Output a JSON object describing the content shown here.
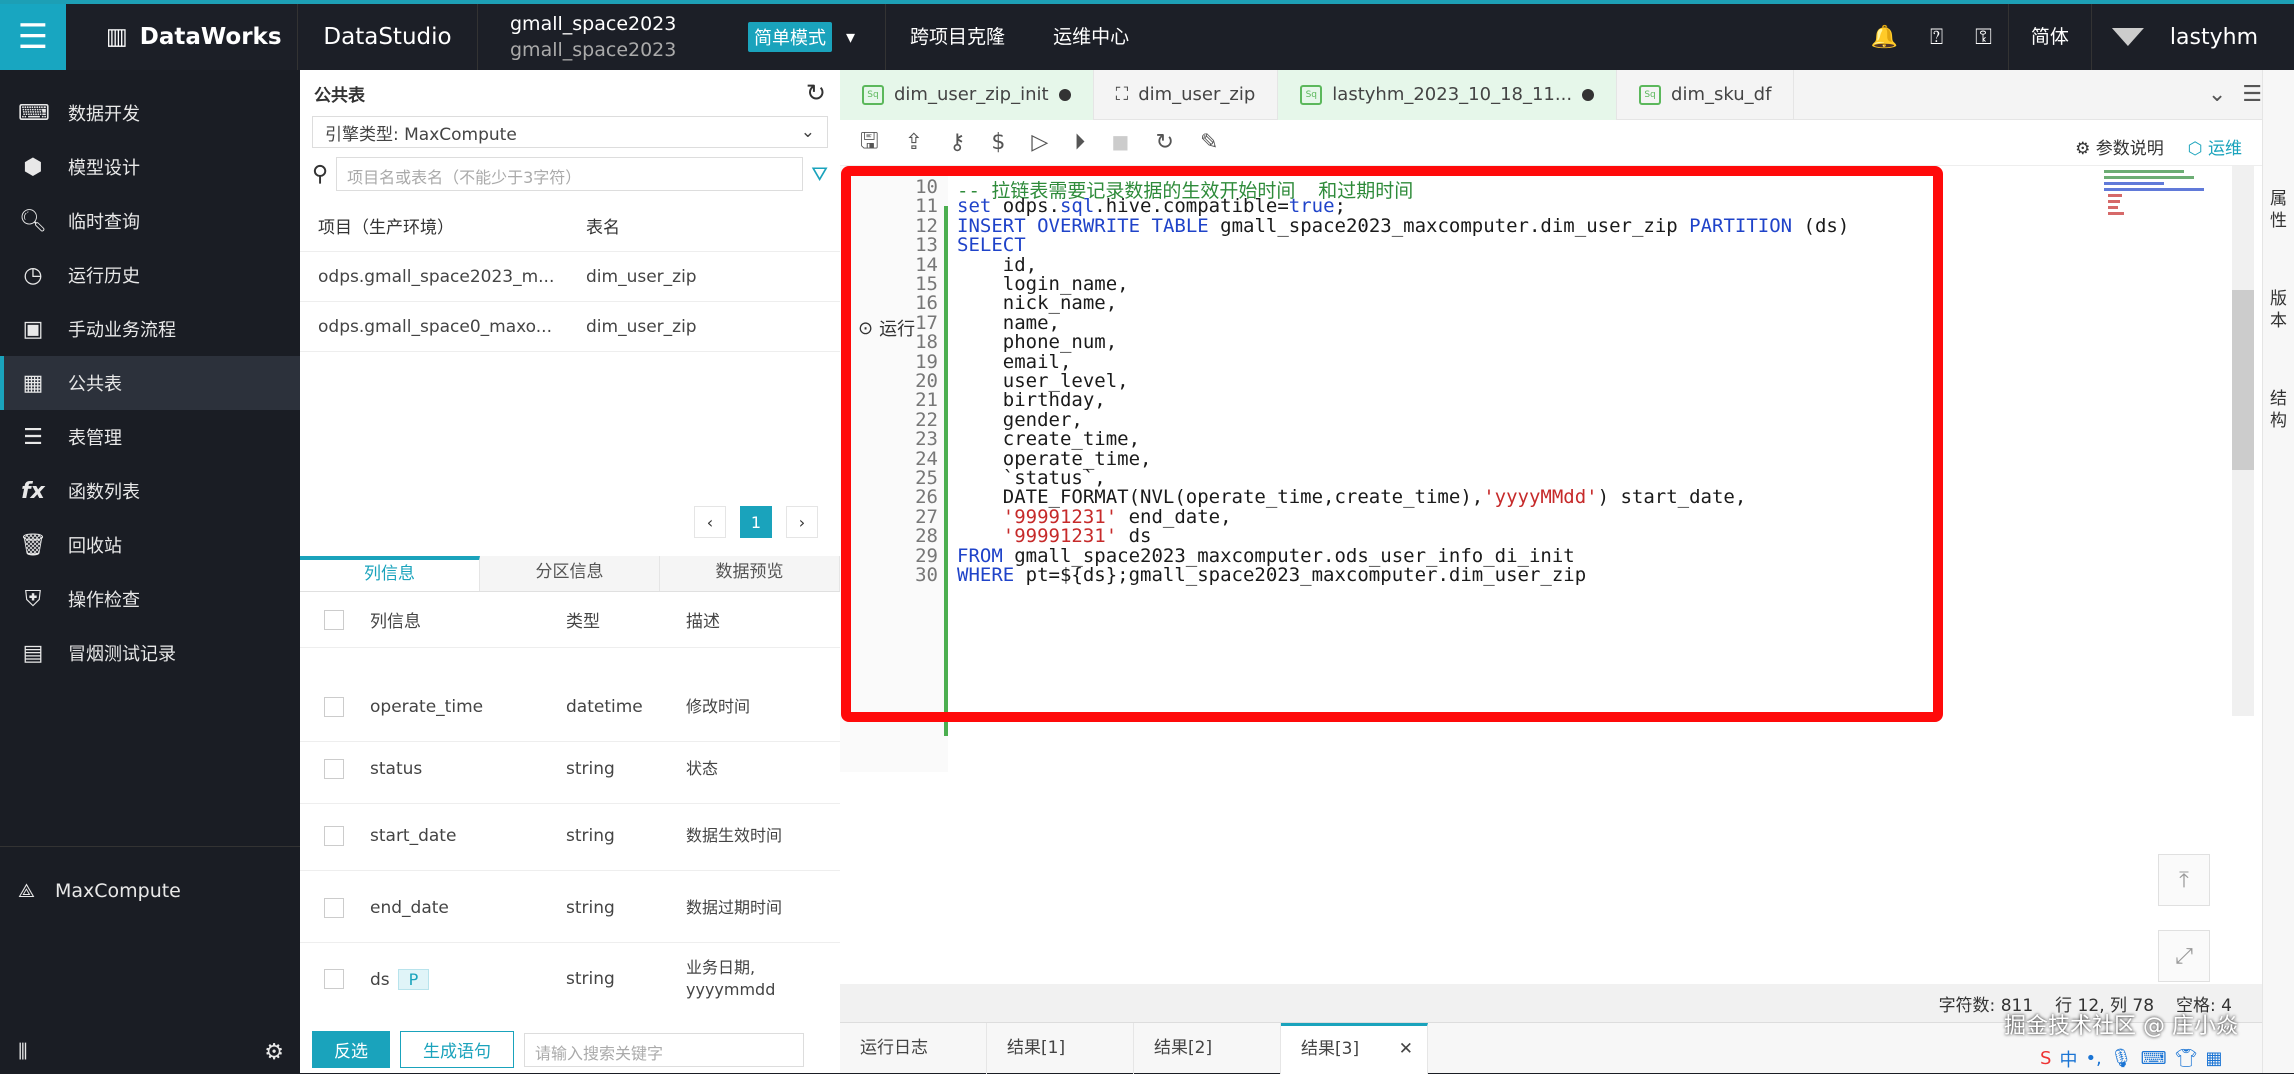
{
  "topbar": {
    "brand": "DataWorks",
    "studio": "DataStudio",
    "project_line1": "gmall_space2023",
    "project_line2": "gmall_space2023",
    "mode": "简单模式",
    "nav": [
      "跨项目克隆",
      "运维中心"
    ],
    "lang": "简体",
    "user": "lastyhm"
  },
  "sidebar": {
    "items": [
      {
        "label": "数据开发",
        "icon": "code-icon"
      },
      {
        "label": "模型设计",
        "icon": "cube-icon"
      },
      {
        "label": "临时查询",
        "icon": "search-icon"
      },
      {
        "label": "运行历史",
        "icon": "clock-icon"
      },
      {
        "label": "手动业务流程",
        "icon": "briefcase-icon"
      },
      {
        "label": "公共表",
        "icon": "table-icon",
        "active": true
      },
      {
        "label": "表管理",
        "icon": "table-manage-icon"
      },
      {
        "label": "函数列表",
        "icon": "function-icon"
      },
      {
        "label": "回收站",
        "icon": "trash-icon"
      },
      {
        "label": "操作检查",
        "icon": "shield-icon"
      },
      {
        "label": "冒烟测试记录",
        "icon": "log-icon"
      }
    ],
    "engine": "MaxCompute"
  },
  "public_table": {
    "title": "公共表",
    "engine_select": "引擎类型:  MaxCompute",
    "search_placeholder": "项目名或表名（不能少于3字符）",
    "col_project": "项目（生产环境）",
    "col_table": "表名",
    "rows": [
      {
        "project": "odps.gmall_space2023_m...",
        "table": "dim_user_zip"
      },
      {
        "project": "odps.gmall_space0_maxo...",
        "table": "dim_user_zip"
      }
    ],
    "page": "1"
  },
  "detail": {
    "tabs": [
      "列信息",
      "分区信息",
      "数据预览"
    ],
    "headers": [
      "列信息",
      "类型",
      "描述"
    ],
    "rows": [
      {
        "name": "operate_time",
        "type": "datetime",
        "desc": "修改时间"
      },
      {
        "name": "status",
        "type": "string",
        "desc": "状态"
      },
      {
        "name": "start_date",
        "type": "string",
        "desc": "数据生效时间"
      },
      {
        "name": "end_date",
        "type": "string",
        "desc": "数据过期时间"
      },
      {
        "name": "ds",
        "type": "string",
        "desc": "业务日期, yyyymmdd",
        "badge": "P"
      }
    ],
    "btn_invert": "反选",
    "btn_generate": "生成语句",
    "search_placeholder": "请输入搜索关键字"
  },
  "editor": {
    "tabs": [
      {
        "label": "dim_user_zip_init",
        "dirty": true
      },
      {
        "label": "dim_user_zip",
        "dirty": false
      },
      {
        "label": "lastyhm_2023_10_18_11...",
        "dirty": true
      },
      {
        "label": "dim_sku_df",
        "dirty": false
      }
    ],
    "toolbar_right": [
      "参数说明",
      "运维"
    ],
    "run_label": "运行",
    "lines": [
      {
        "n": "10",
        "t": "-- 拉链表需要记录数据的生效开始时间  和过期时间"
      },
      {
        "n": "11",
        "t": "set odps.sql.hive.compatible=true;"
      },
      {
        "n": "12",
        "t": "INSERT OVERWRITE TABLE gmall_space2023_maxcomputer.dim_user_zip PARTITION (ds)"
      },
      {
        "n": "13",
        "t": "SELECT"
      },
      {
        "n": "14",
        "t": "    id,"
      },
      {
        "n": "15",
        "t": "    login_name,"
      },
      {
        "n": "16",
        "t": "    nick_name,"
      },
      {
        "n": "17",
        "t": "    name,"
      },
      {
        "n": "18",
        "t": "    phone_num,"
      },
      {
        "n": "19",
        "t": "    email,"
      },
      {
        "n": "20",
        "t": "    user_level,"
      },
      {
        "n": "21",
        "t": "    birthday,"
      },
      {
        "n": "22",
        "t": "    gender,"
      },
      {
        "n": "23",
        "t": "    create_time,"
      },
      {
        "n": "24",
        "t": "    operate_time,"
      },
      {
        "n": "25",
        "t": "    `status`,"
      },
      {
        "n": "26",
        "t": "    DATE_FORMAT(NVL(operate_time,create_time),'yyyyMMdd') start_date,"
      },
      {
        "n": "27",
        "t": "    '99991231' end_date,"
      },
      {
        "n": "28",
        "t": "    '99991231' ds"
      },
      {
        "n": "29",
        "t": "FROM gmall_space2023_maxcomputer.ods_user_info_di_init"
      },
      {
        "n": "30",
        "t": "WHERE pt=${ds};gmall_space2023_maxcomputer.dim_user_zip"
      }
    ],
    "status": {
      "chars": "字符数: 811",
      "pos": "行 12, 列 78",
      "indent": "空格: 4"
    },
    "result_tabs": [
      "运行日志",
      "结果[1]",
      "结果[2]",
      "结果[3]"
    ],
    "right_panel": [
      "属性",
      "版本",
      "结构"
    ]
  },
  "watermark": "掘金技术社区 @ 庄小焱",
  "colors": {
    "accent": "#1aa3bc",
    "highlight": "#ff0a0a"
  }
}
